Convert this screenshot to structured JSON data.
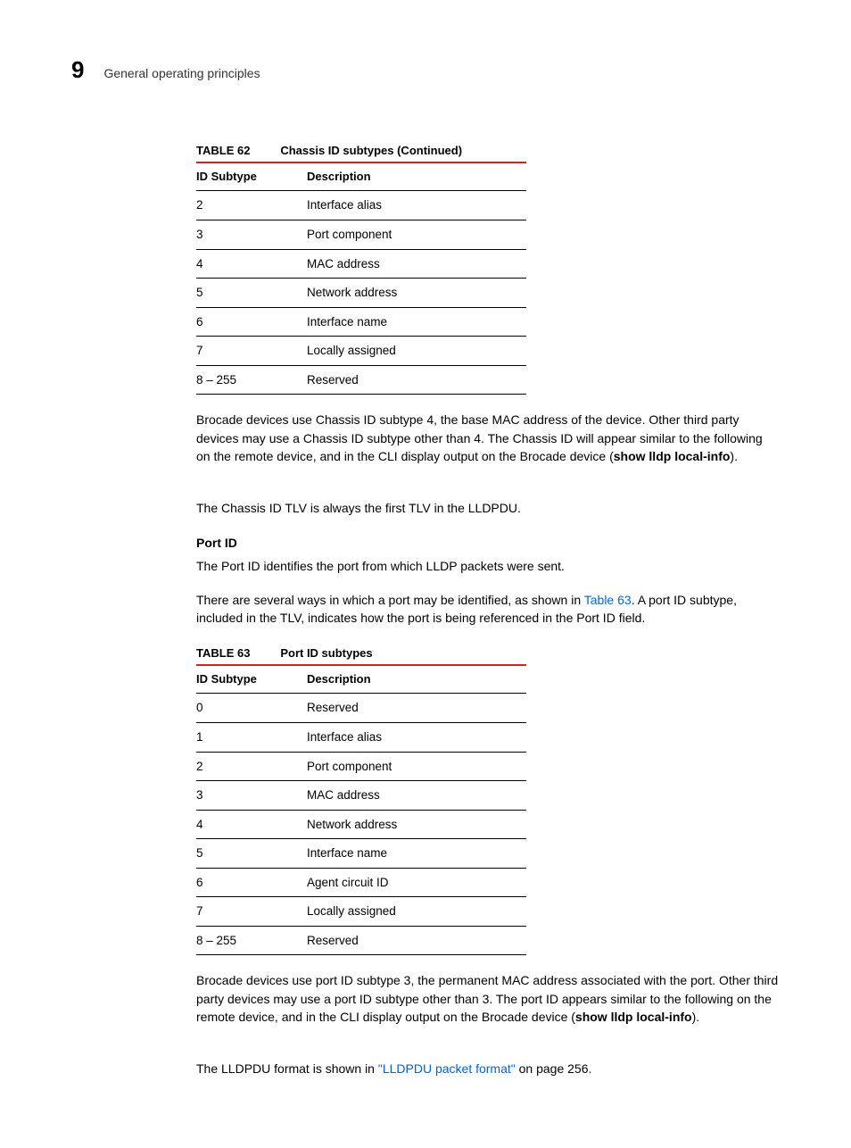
{
  "header": {
    "chapter": "9",
    "section": "General operating principles"
  },
  "table62": {
    "label": "TABLE 62",
    "caption": "Chassis ID subtypes (Continued)",
    "head": {
      "c1": "ID Subtype",
      "c2": "Description"
    },
    "rows": [
      {
        "c1": "2",
        "c2": "Interface alias"
      },
      {
        "c1": "3",
        "c2": "Port component"
      },
      {
        "c1": "4",
        "c2": "MAC address"
      },
      {
        "c1": "5",
        "c2": "Network address"
      },
      {
        "c1": "6",
        "c2": "Interface name"
      },
      {
        "c1": "7",
        "c2": "Locally assigned"
      },
      {
        "c1": "8 – 255",
        "c2": "Reserved"
      }
    ]
  },
  "para1_a": "Brocade devices use Chassis ID subtype 4, the base MAC address of the device.  Other third party devices may use a Chassis ID subtype other than 4.  The Chassis ID will appear similar to the following on the remote device, and in the CLI display output on the Brocade device (",
  "para1_b": "show lldp local-info",
  "para1_c": ").",
  "para2": "The Chassis ID TLV is always the first TLV in the LLDPDU.",
  "portid_heading": "Port ID",
  "para3": "The Port ID identifies the port from which LLDP packets were sent.",
  "para4_a": "There are several ways in which a port may be identified, as shown in ",
  "para4_link": "Table 63",
  "para4_b": ".  A port ID subtype, included in the TLV, indicates how the port is being referenced in the Port ID field.",
  "table63": {
    "label": "TABLE 63",
    "caption": "Port ID subtypes",
    "head": {
      "c1": "ID Subtype",
      "c2": "Description"
    },
    "rows": [
      {
        "c1": "0",
        "c2": "Reserved"
      },
      {
        "c1": "1",
        "c2": "Interface alias"
      },
      {
        "c1": "2",
        "c2": "Port component"
      },
      {
        "c1": "3",
        "c2": "MAC address"
      },
      {
        "c1": "4",
        "c2": "Network address"
      },
      {
        "c1": "5",
        "c2": "Interface name"
      },
      {
        "c1": "6",
        "c2": "Agent circuit ID"
      },
      {
        "c1": "7",
        "c2": "Locally assigned"
      },
      {
        "c1": "8 – 255",
        "c2": "Reserved"
      }
    ]
  },
  "para5_a": "Brocade devices use port ID subtype 3, the permanent MAC address associated with the port. Other third party devices may use a port ID subtype other than 3. The port ID appears similar to the following on the remote device, and in the CLI display output on the Brocade device (",
  "para5_b": "show lldp local-info",
  "para5_c": ").",
  "para6_a": "The LLDPDU format is shown in ",
  "para6_link": "\"LLDPDU packet format\"",
  "para6_b": " on page 256."
}
